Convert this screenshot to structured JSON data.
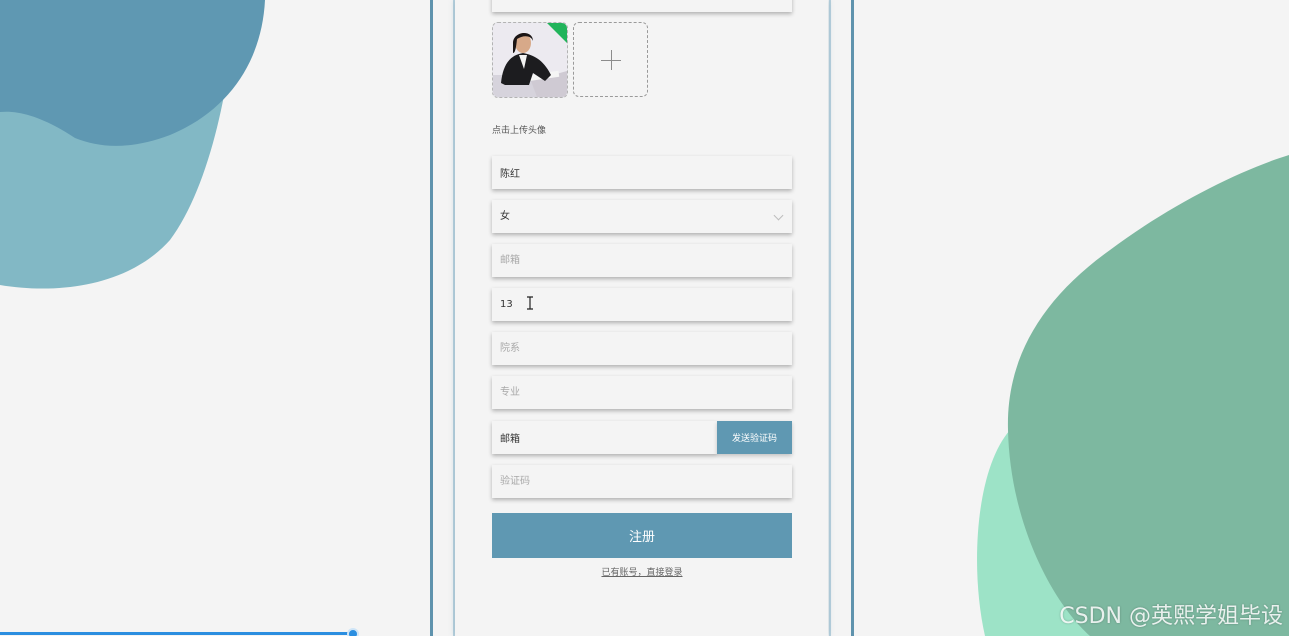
{
  "avatar": {
    "hint": "点击上传头像"
  },
  "form": {
    "name_value": "陈红",
    "gender_value": "女",
    "email_placeholder": "邮箱",
    "phone_value": "13",
    "department_placeholder": "院系",
    "major_placeholder": "专业",
    "email_code_value": "邮箱",
    "send_code_label": "发送验证码",
    "code_placeholder": "验证码",
    "register_label": "注册",
    "login_link": "已有账号，直接登录"
  },
  "watermark": "CSDN @英熙学姐毕设",
  "colors": {
    "accent": "#5f98b2",
    "frame": "#5f93ad",
    "blob_blue_dark": "#5f98b2",
    "blob_blue_light": "#82b8c5",
    "blob_green_dark": "#7db8a0",
    "blob_green_light": "#9de3c7",
    "progress": "#2b8ee0"
  },
  "icons": {
    "upload": "plus-icon",
    "select": "chevron-down-icon",
    "cursor": "text-cursor-icon"
  }
}
